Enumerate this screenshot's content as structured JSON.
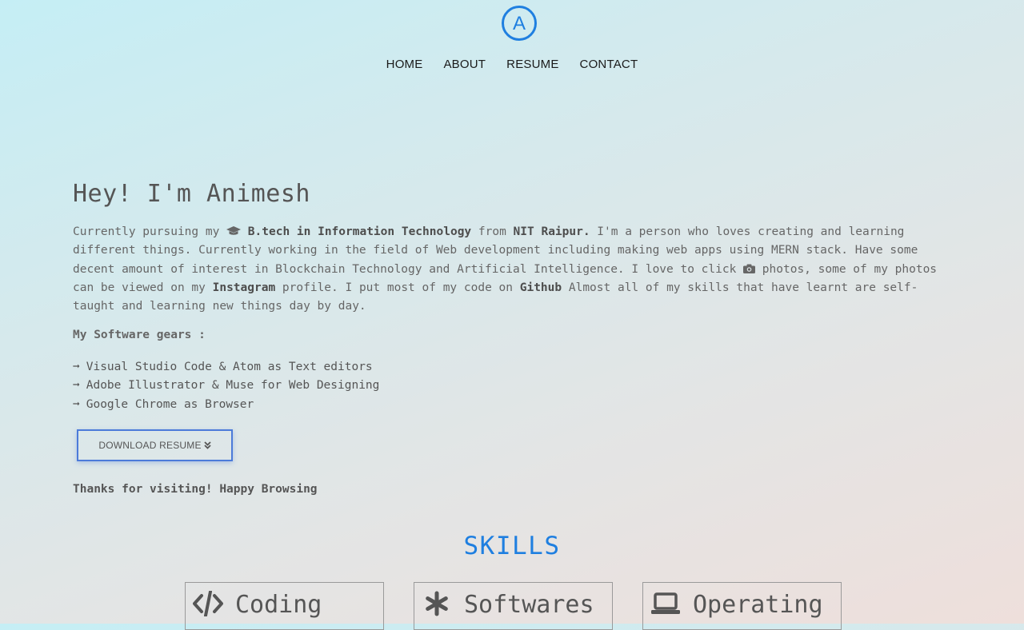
{
  "logo": {
    "letter": "A",
    "icon": "circle-a-logo",
    "color": "#1f7fe0"
  },
  "nav": [
    {
      "label": "HOME"
    },
    {
      "label": "ABOUT"
    },
    {
      "label": "RESUME"
    },
    {
      "label": "CONTACT"
    }
  ],
  "about": {
    "headline": "Hey! I'm Animesh",
    "intro": {
      "t1": "Currently pursuing my ",
      "cap_icon": "graduation-cap-icon",
      "b1": "B.tech in Information Technology",
      "t2": " from ",
      "b2": "NIT Raipur.",
      "t3": " I'm a person who loves creating and learning different things. Currently working in the field of Web development including making web apps using MERN stack. Have some decent amount of interest in Blockchain Technology and Artificial Intelligence. I love to click ",
      "camera_icon": "camera-icon",
      "t4": " photos, some of my photos can be viewed on my ",
      "b3": "Instagram",
      "t5": " profile. I put most of my code on ",
      "b4": "Github",
      "t6": " Almost all of my skills that have learnt are self-taught and learning new things day by day."
    },
    "gears_title": "My Software gears :",
    "gears": [
      {
        "arrow": "➞",
        "text": "Visual Studio Code & Atom as Text editors"
      },
      {
        "arrow": "➞",
        "text": "Adobe Illustrator & Muse for Web Designing"
      },
      {
        "arrow": "➞",
        "text": "Google Chrome as Browser"
      }
    ],
    "download_label": "DOWNLOAD RESUME",
    "download_icon": "double-chevron-down-icon",
    "thanks": "Thanks for visiting! Happy Browsing"
  },
  "skills": {
    "title": "SKILLS",
    "cards": [
      {
        "label": "Coding",
        "icon": "code-icon"
      },
      {
        "label": "Softwares",
        "icon": "asterisk-icon"
      },
      {
        "label": "Operating",
        "icon": "laptop-icon"
      }
    ]
  },
  "colors": {
    "accent": "#1f7fe0",
    "button_border": "#4c7bd9",
    "text": "#5c5c5c"
  }
}
